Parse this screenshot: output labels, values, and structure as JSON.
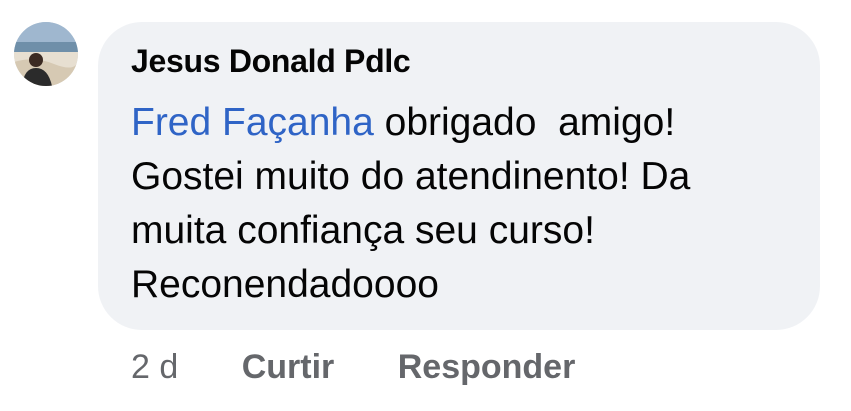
{
  "comment": {
    "author": "Jesus Donald Pdlc",
    "mention": "Fred Façanha",
    "lines": [
      " obrigado  amigo!",
      "Gostei muito do atendinento! Da",
      "muita confiança seu curso!",
      "Reconendadoooo"
    ],
    "time": "2 d",
    "like_label": "Curtir",
    "reply_label": "Responder"
  },
  "colors": {
    "bubble": "#f0f2f5",
    "mention": "#2f64c6",
    "text": "#050505",
    "secondary": "#65676b"
  }
}
